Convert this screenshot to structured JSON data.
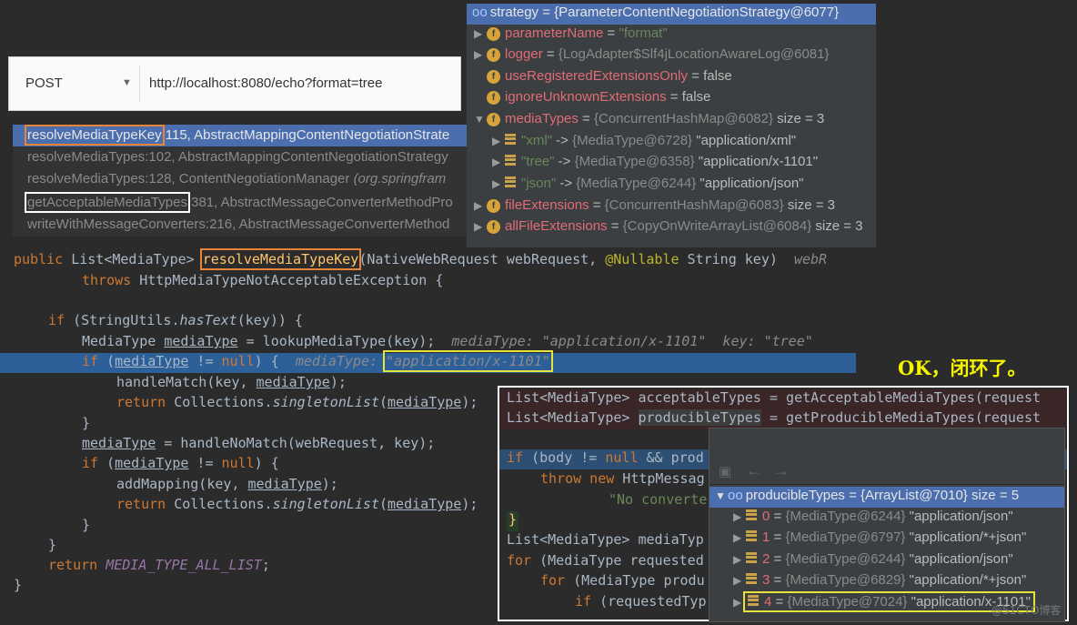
{
  "request": {
    "method": "POST",
    "url": "http://localhost:8080/echo?format=tree"
  },
  "frames": [
    {
      "method": "resolveMediaTypeKey",
      "rest": ":115, AbstractMappingContentNegotiationStrate"
    },
    {
      "method": "resolveMediaTypes",
      "rest": ":102, AbstractMappingContentNegotiationStrategy"
    },
    {
      "method": "resolveMediaTypes",
      "rest": ":128, ContentNegotiationManager ",
      "pkg": "(org.springfram"
    },
    {
      "method": "getAcceptableMediaTypes",
      "rest": ":381, AbstractMessageConverterMethodPro"
    },
    {
      "method": "writeWithMessageConverters",
      "rest": ":216, AbstractMessageConverterMethod"
    }
  ],
  "variables": {
    "root": {
      "name": "strategy",
      "value": "= {ParameterContentNegotiationStrategy@6077}"
    },
    "fields": [
      {
        "name": "parameterName",
        "eq": " = ",
        "value": "\"format\"",
        "kind": "string"
      },
      {
        "name": "logger",
        "eq": " = ",
        "value": "{LogAdapter$Slf4jLocationAwareLog@6081}",
        "kind": "ref"
      },
      {
        "name": "useRegisteredExtensionsOnly",
        "eq": " = ",
        "value": "false",
        "kind": "plain"
      },
      {
        "name": "ignoreUnknownExtensions",
        "eq": " = ",
        "value": "false",
        "kind": "plain"
      },
      {
        "name": "mediaTypes",
        "eq": " = ",
        "value": "{ConcurrentHashMap@6082}",
        "extra": "  size = 3",
        "kind": "ref"
      }
    ],
    "entries": [
      {
        "key": "\"xml\"",
        "arrow": " -> ",
        "ref": "{MediaType@6728}",
        "val": " \"application/xml\""
      },
      {
        "key": "\"tree\"",
        "arrow": " -> ",
        "ref": "{MediaType@6358}",
        "val": " \"application/x-1101\""
      },
      {
        "key": "\"json\"",
        "arrow": " -> ",
        "ref": "{MediaType@6244}",
        "val": " \"application/json\""
      }
    ],
    "tail": [
      {
        "name": "fileExtensions",
        "eq": " = ",
        "value": "{ConcurrentHashMap@6083}",
        "extra": "  size = 3"
      },
      {
        "name": "allFileExtensions",
        "eq": " = ",
        "value": "{CopyOnWriteArrayList@6084}",
        "extra": "  size = 3"
      }
    ]
  },
  "code": {
    "l1_public": "public ",
    "l1_type": "List<MediaType> ",
    "l1_method": "resolveMediaTypeKey",
    "l1_params_a": "(NativeWebRequest webRequest, ",
    "l1_ann": "@Nullable",
    "l1_params_b": " String key)  ",
    "l1_hint": "webR",
    "l2_throws": "throws",
    "l2_rest": " HttpMediaTypeNotAcceptableException {",
    "l3_if": "if",
    "l3_a": " (StringUtils.",
    "l3_static": "hasText",
    "l3_b": "(key)) {",
    "l4_a": "MediaType ",
    "l4_var": "mediaType",
    "l4_b": " = lookupMediaType(key);  ",
    "l4_hint": "mediaType: \"application/x-1101\"  key: \"tree\"",
    "l5_if": "if",
    "l5_a": " (",
    "l5_var": "mediaType",
    "l5_b": " != ",
    "l5_null": "null",
    "l5_c": ") {  ",
    "l5_hint_a": "mediaType: ",
    "l5_hint_b": "\"application/x-1101\"",
    "l6_a": "handleMatch(key, ",
    "l6_var": "mediaType",
    "l6_b": ");",
    "l7_return": "return",
    "l7_a": " Collections.",
    "l7_static": "singletonList",
    "l7_b": "(",
    "l7_var": "mediaType",
    "l7_c": ");",
    "brace": "}",
    "l9_var": "mediaType",
    "l9_a": " = handleNoMatch(webRequest, key);",
    "l10_if": "if",
    "l10_a": " (",
    "l10_var": "mediaType",
    "l10_b": " != ",
    "l10_null": "null",
    "l10_c": ") {",
    "l11_a": "addMapping(key, ",
    "l11_var": "mediaType",
    "l11_b": ");",
    "l12_return": "return",
    "l12_a": " Collections.",
    "l12_static": "singletonList",
    "l12_b": "(",
    "l12_var": "mediaType",
    "l12_c": ");",
    "l15_return": "return",
    "l15_const": "MEDIA_TYPE_ALL_LIST",
    "l15_semi": ";"
  },
  "ok_label": "OK，闭环了。",
  "panel2": {
    "p1_a": "List<MediaType> acceptableTypes = getAcceptableMediaTypes(request",
    "p2_a": "List<MediaType> ",
    "p2_var": "producibleTypes",
    "p2_b": " = getProducibleMediaTypes(request",
    "p3_if": "if",
    "p3_a": " (body != ",
    "p3_null": "null",
    "p3_b": " && prod",
    "p4_throw": "throw new",
    "p4_a": " HttpMessag",
    "p5_str": "\"No converte",
    "p6_brace": "}",
    "p7_a": "List<MediaType> mediaTyp",
    "p8_for": "for",
    "p8_a": " (MediaType requested",
    "p9_for": "for",
    "p9_a": " (MediaType produ",
    "p10_if": "if",
    "p10_a": " (requestedTyp"
  },
  "popup": {
    "back": "←",
    "forward": "→",
    "root_name": "producibleTypes",
    "root_value": " = {ArrayList@7010}  size = 5",
    "items": [
      {
        "idx": "0",
        "ref": "{MediaType@6244}",
        "val": " \"application/json\""
      },
      {
        "idx": "1",
        "ref": "{MediaType@6797}",
        "val": " \"application/*+json\""
      },
      {
        "idx": "2",
        "ref": "{MediaType@6244}",
        "val": " \"application/json\""
      },
      {
        "idx": "3",
        "ref": "{MediaType@6829}",
        "val": " \"application/*+json\""
      },
      {
        "idx": "4",
        "ref": "{MediaType@7024}",
        "val": " \"application/x-1101\""
      }
    ]
  },
  "watermark": "@51CTO博客"
}
